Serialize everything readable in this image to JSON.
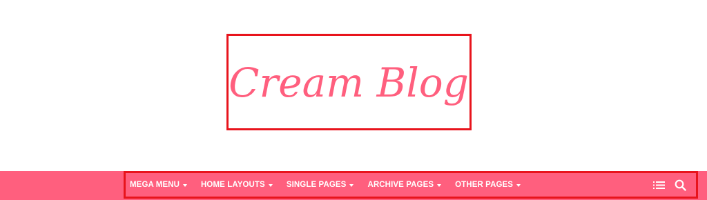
{
  "logo": {
    "text": "Cream Blog",
    "color": "#ff5f7e",
    "outline_color": "#e8141c"
  },
  "nav": {
    "background": "#ff5f7e",
    "items": [
      {
        "label": "MEGA MENU",
        "icon": "caret-down-icon"
      },
      {
        "label": "HOME LAYOUTS",
        "icon": "caret-down-icon"
      },
      {
        "label": "SINGLE PAGES",
        "icon": "caret-down-icon"
      },
      {
        "label": "ARCHIVE PAGES",
        "icon": "caret-down-icon"
      },
      {
        "label": "OTHER PAGES",
        "icon": "caret-down-icon"
      }
    ],
    "tools": [
      "menu-list-icon",
      "search-icon"
    ]
  }
}
